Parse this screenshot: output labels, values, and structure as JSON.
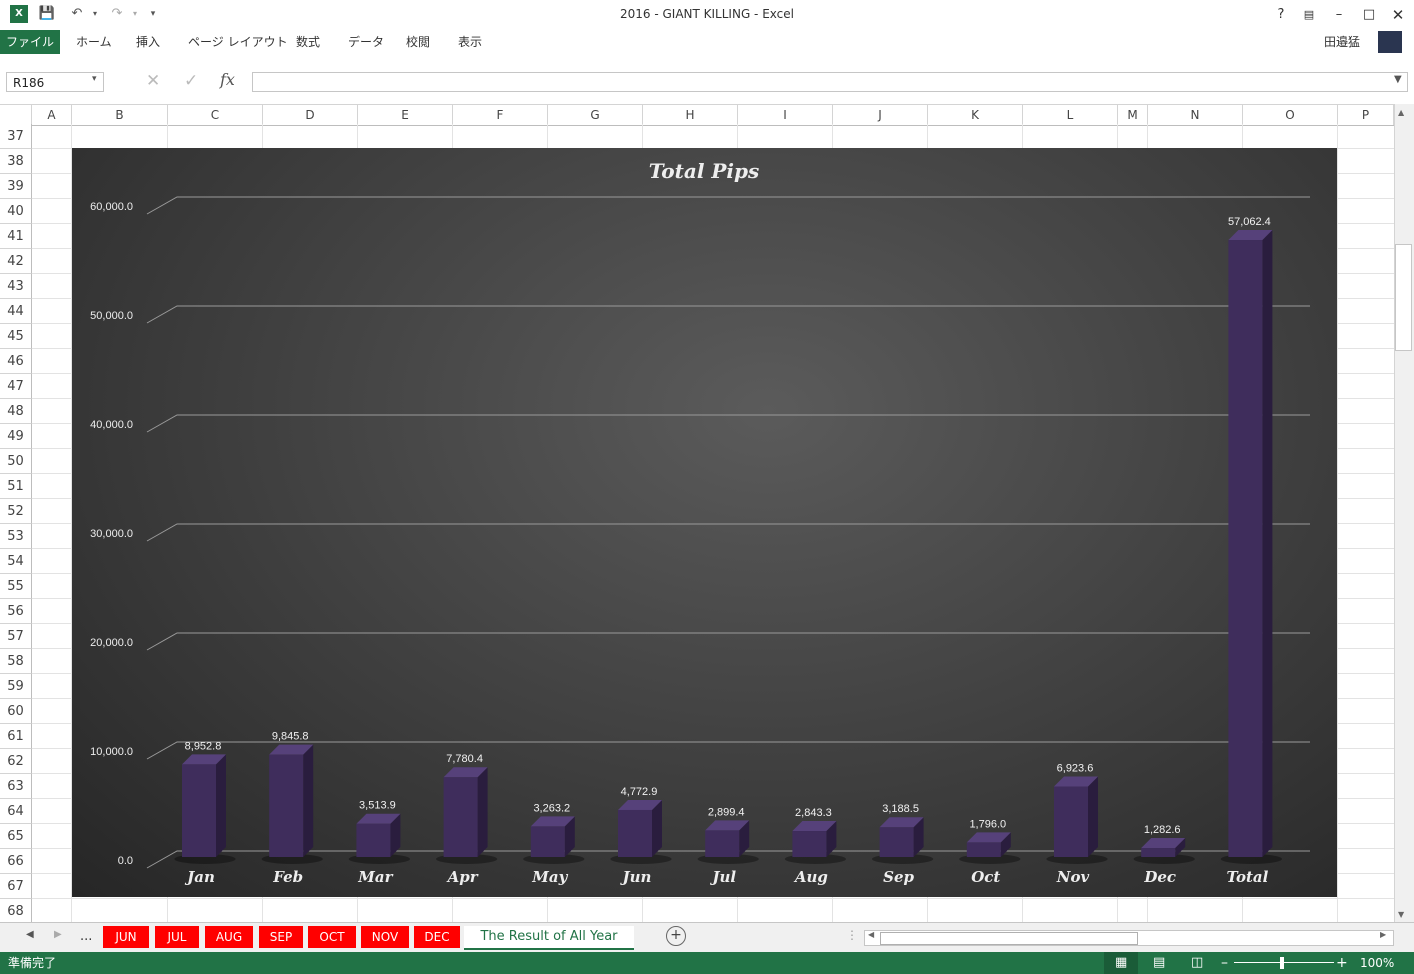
{
  "window": {
    "title": "2016 - GIANT KILLING - Excel",
    "user": "田邉猛",
    "help": "?"
  },
  "ribbon": {
    "tabs": [
      "ファイル",
      "ホーム",
      "挿入",
      "ページ レイアウト",
      "数式",
      "データ",
      "校閲",
      "表示"
    ]
  },
  "formula_bar": {
    "name_box": "R186",
    "formula": ""
  },
  "columns": [
    "A",
    "B",
    "C",
    "D",
    "E",
    "F",
    "G",
    "H",
    "I",
    "J",
    "K",
    "L",
    "M",
    "N",
    "O",
    "P"
  ],
  "rows": [
    "37",
    "38",
    "39",
    "40",
    "41",
    "42",
    "43",
    "44",
    "45",
    "46",
    "47",
    "48",
    "49",
    "50",
    "51",
    "52",
    "53",
    "54",
    "55",
    "56",
    "57",
    "58",
    "59",
    "60",
    "61",
    "62",
    "63",
    "64",
    "65",
    "66",
    "67",
    "68"
  ],
  "sheets": {
    "nav_more": "...",
    "tabs": [
      "JUN",
      "JUL",
      "AUG",
      "SEP",
      "OCT",
      "NOV",
      "DEC"
    ],
    "active": "The Result of All Year"
  },
  "status": {
    "ready": "準備完了",
    "zoom": "100%"
  },
  "colors": {
    "accent": "#217346",
    "tab_red": "#ff0000",
    "bar": "#3f2d5c"
  },
  "chart_data": {
    "type": "bar",
    "title": "Total Pips",
    "categories": [
      "Jan",
      "Feb",
      "Mar",
      "Apr",
      "May",
      "Jun",
      "Jul",
      "Aug",
      "Sep",
      "Oct",
      "Nov",
      "Dec",
      "Total"
    ],
    "values": [
      8952.8,
      9845.8,
      3513.9,
      7780.4,
      3263.2,
      4772.9,
      2899.4,
      2843.3,
      3188.5,
      1796.0,
      6923.6,
      1282.6,
      57062.4
    ],
    "value_labels": [
      "8,952.8",
      "9,845.8",
      "3,513.9",
      "7,780.4",
      "3,263.2",
      "4,772.9",
      "2,899.4",
      "2,843.3",
      "3,188.5",
      "1,796.0",
      "6,923.6",
      "1,282.6",
      "57,062.4"
    ],
    "yticks": [
      "0.0",
      "10,000.0",
      "20,000.0",
      "30,000.0",
      "40,000.0",
      "50,000.0",
      "60,000.0"
    ],
    "ylim": [
      0,
      60000
    ],
    "grid": true,
    "legend": "none"
  }
}
